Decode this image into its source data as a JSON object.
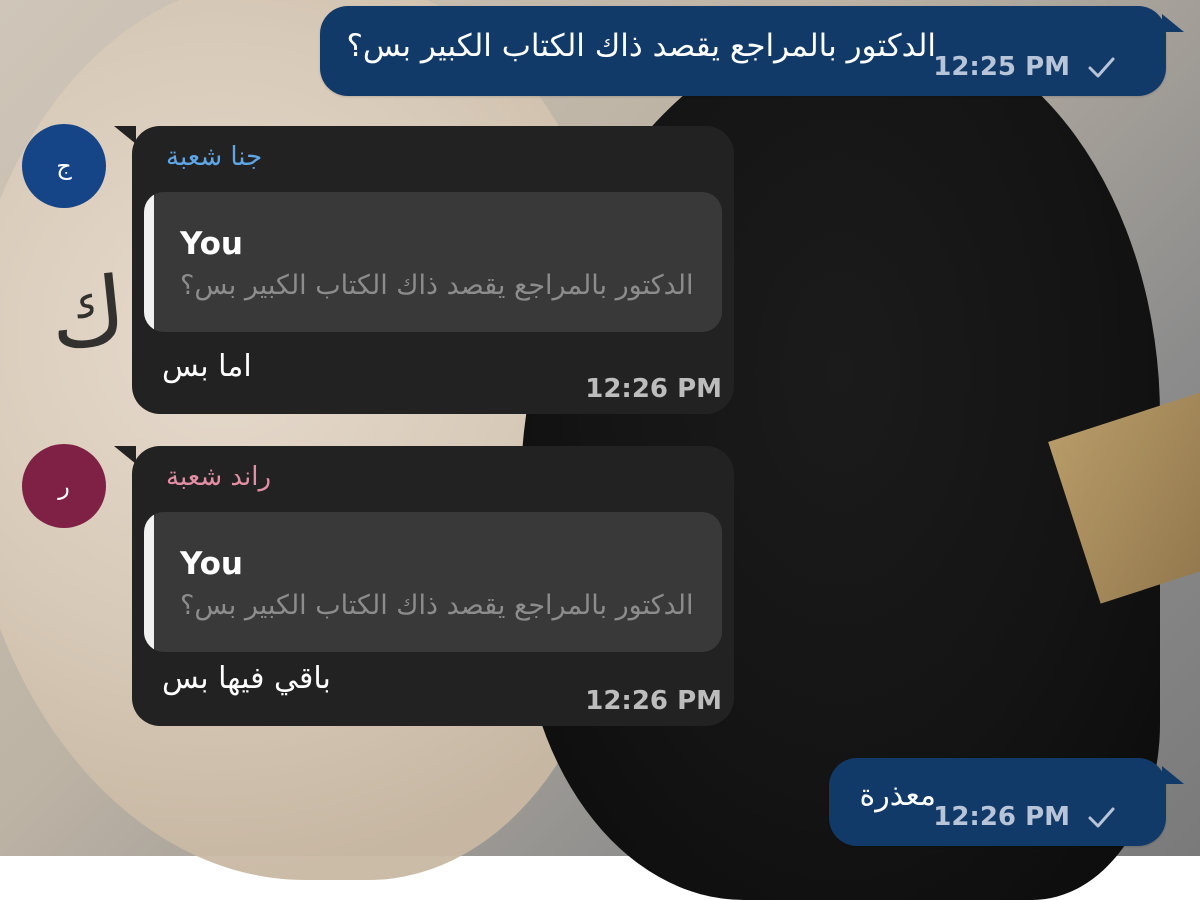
{
  "theme": {
    "outgoing_bubble": "#123a69",
    "incoming_bubble": "#222222",
    "reply_background": "#393939",
    "reply_accent": "#f1f1f1",
    "sender_blue": "#5fa6e6",
    "sender_pink": "#e38ea4",
    "avatar_blue": "#154487",
    "avatar_maroon": "#7e2145",
    "timestamp_gray": "#bdbdbd"
  },
  "messages": [
    {
      "type": "outgoing",
      "text": "الدكتور بالمراجع يقصد ذاك الكتاب الكبير بس؟",
      "time": "12:25 PM",
      "status_icon": "checkmark-icon"
    },
    {
      "type": "incoming",
      "avatar": "ج",
      "sender": "جنا شعبة",
      "reply": {
        "author": "You",
        "preview": "الدكتور بالمراجع يقصد ذاك الكتاب الكبير بس؟"
      },
      "text": "اما بس",
      "time": "12:26 PM"
    },
    {
      "type": "incoming",
      "avatar": "ر",
      "sender": "راند شعبة",
      "reply": {
        "author": "You",
        "preview": "الدكتور بالمراجع يقصد ذاك الكتاب الكبير بس؟"
      },
      "text": "باقي فيها بس",
      "time": "12:26 PM"
    },
    {
      "type": "outgoing",
      "text": "معذرة",
      "time": "12:26 PM",
      "status_icon": "checkmark-icon"
    }
  ]
}
